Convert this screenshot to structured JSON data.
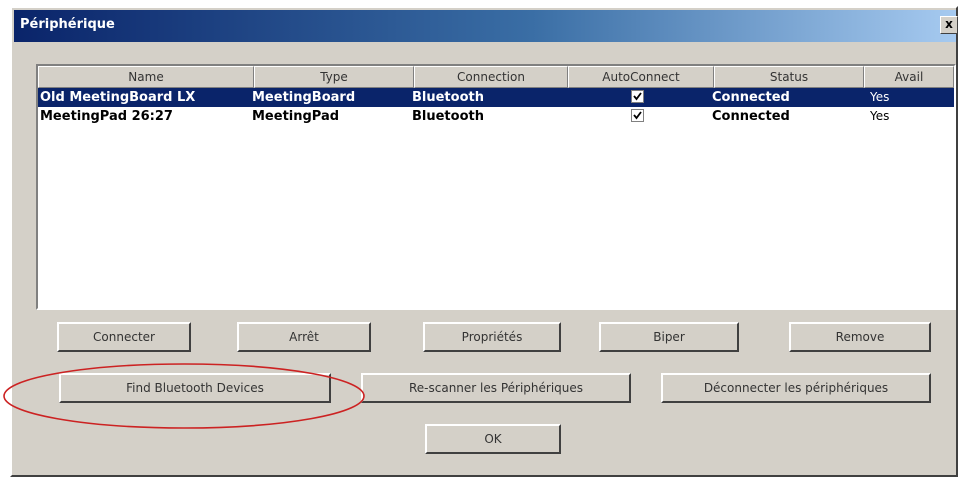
{
  "window": {
    "title": "Périphérique",
    "close_symbol": "x"
  },
  "table": {
    "columns": [
      "Name",
      "Type",
      "Connection",
      "AutoConnect",
      "Status",
      "Avail"
    ],
    "rows": [
      {
        "name": "Old MeetingBoard LX",
        "type": "MeetingBoard",
        "connection": "Bluetooth",
        "autoconnect": true,
        "status": "Connected",
        "avail": "Yes",
        "selected": true
      },
      {
        "name": "MeetingPad 26:27",
        "type": "MeetingPad",
        "connection": "Bluetooth",
        "autoconnect": true,
        "status": "Connected",
        "avail": "Yes",
        "selected": false
      }
    ]
  },
  "buttons": {
    "connect": "Connecter",
    "stop": "Arrêt",
    "properties": "Propriétés",
    "beep": "Biper",
    "remove": "Remove",
    "find_bluetooth": "Find Bluetooth Devices",
    "rescan": "Re-scanner les Périphériques",
    "disconnect": "Déconnecter les périphériques",
    "ok": "OK"
  },
  "colors": {
    "selection": "#0a246a",
    "annotation": "#cc2222"
  }
}
